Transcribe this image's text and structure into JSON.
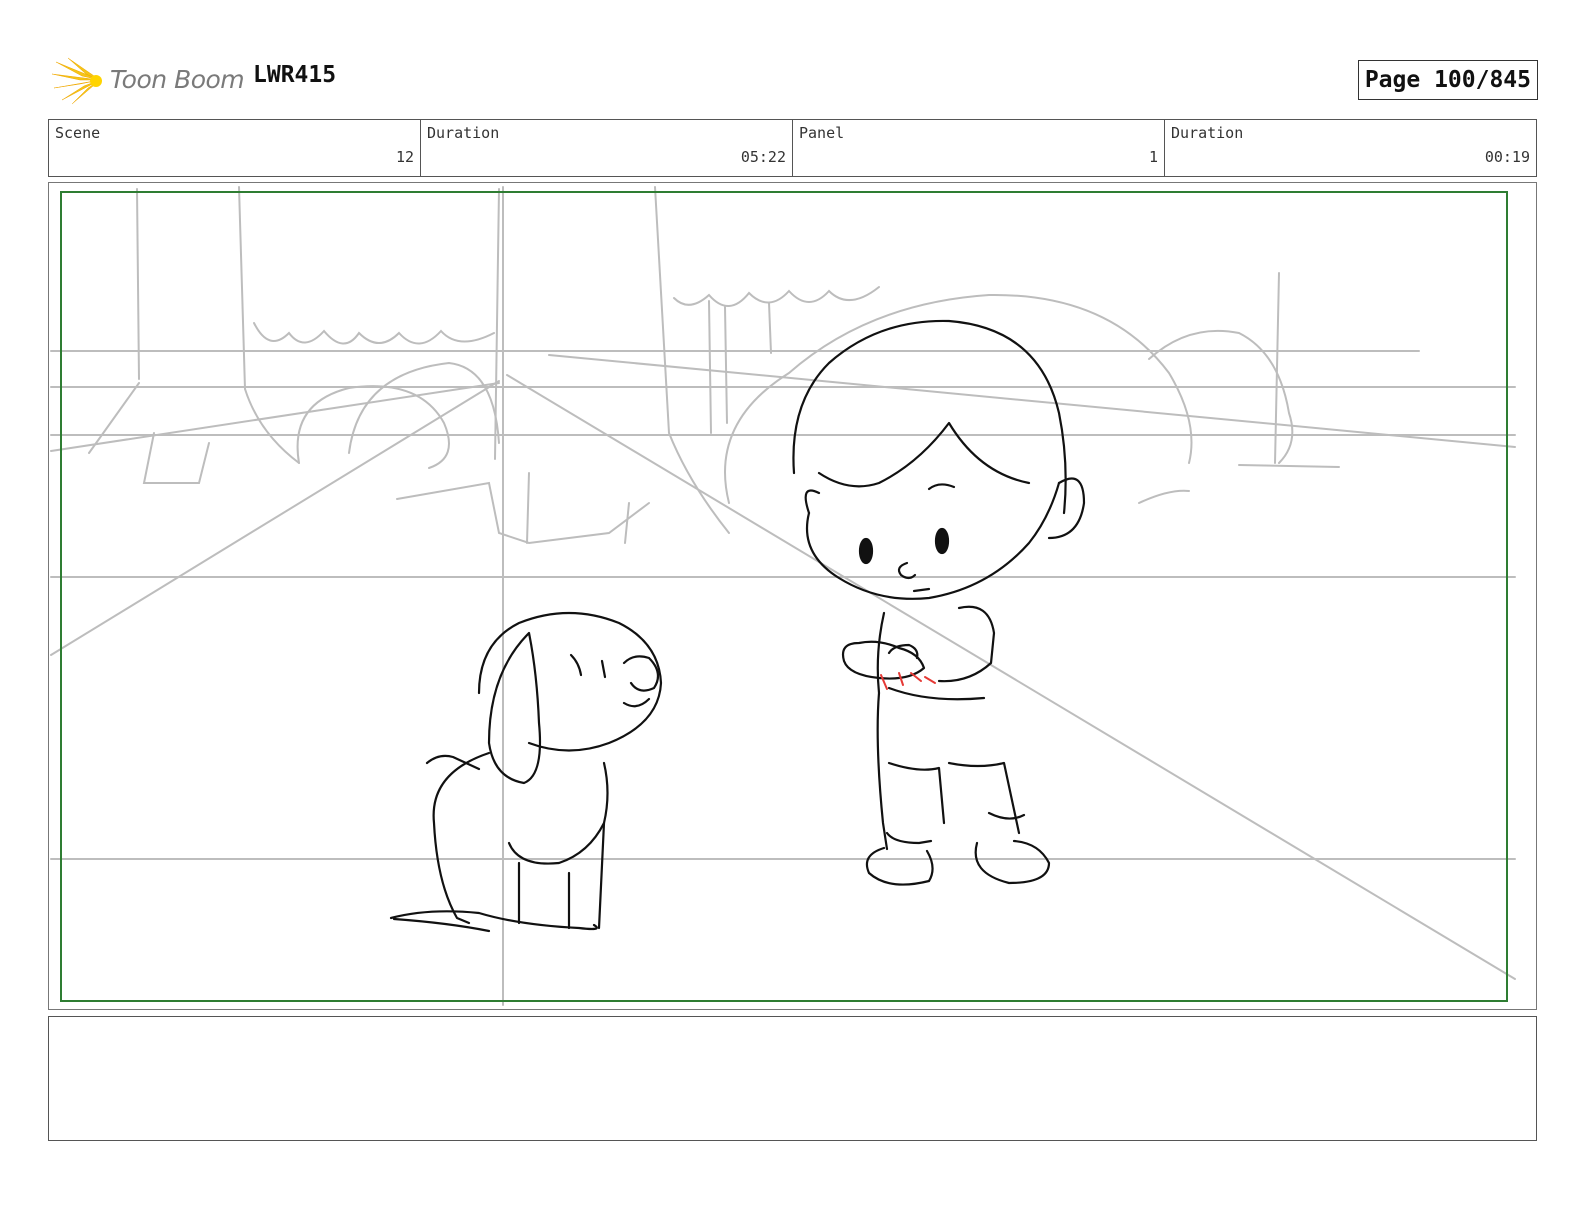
{
  "header": {
    "brand_name": "Toon Boom",
    "project_id": "LWR415",
    "page_indicator": "Page 100/845"
  },
  "info_bar": [
    {
      "label": "Scene",
      "value": "12"
    },
    {
      "label": "Duration",
      "value": "05:22"
    },
    {
      "label": "Panel",
      "value": "1"
    },
    {
      "label": "Duration",
      "value": "00:19"
    }
  ],
  "panel": {
    "description": "",
    "safe_frame_color": "#2e7d32",
    "red_accent_color": "#e53935"
  },
  "notes": {
    "text": ""
  }
}
